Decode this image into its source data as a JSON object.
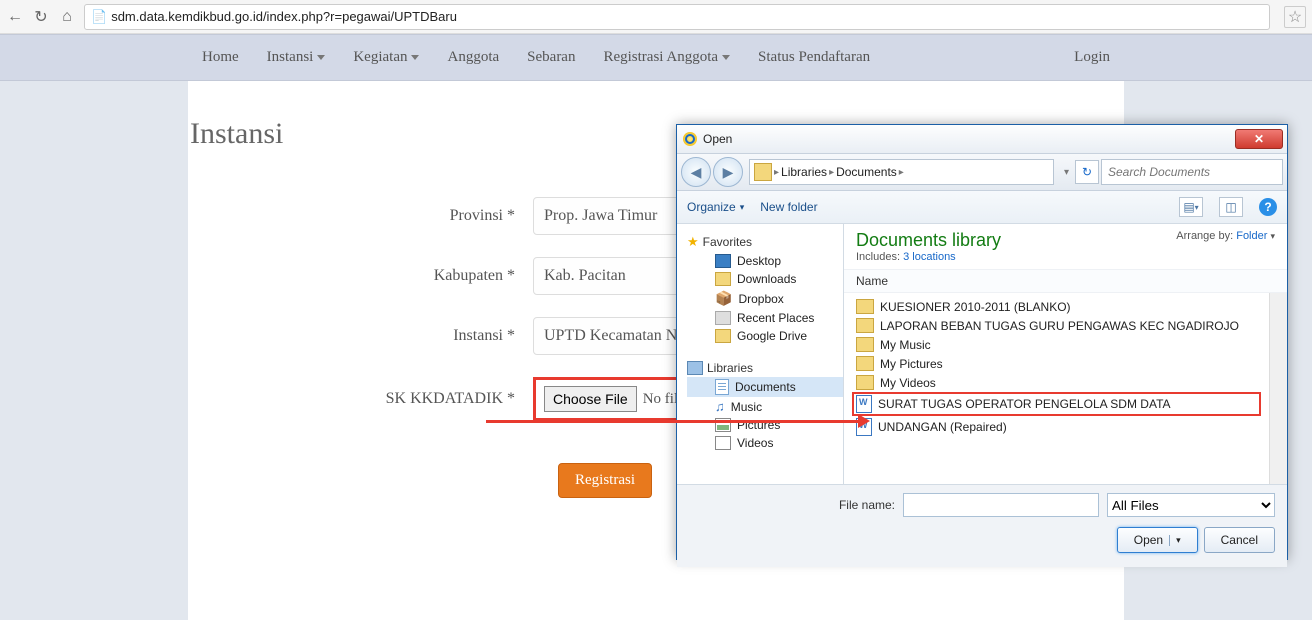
{
  "browser": {
    "url": "sdm.data.kemdikbud.go.id/index.php?r=pegawai/UPTDBaru"
  },
  "nav": {
    "items": [
      "Home",
      "Instansi",
      "Kegiatan",
      "Anggota",
      "Sebaran",
      "Registrasi Anggota",
      "Status Pendaftaran"
    ],
    "dropdown_flags": [
      false,
      true,
      true,
      false,
      false,
      true,
      false
    ],
    "login": "Login"
  },
  "page": {
    "title": "Instansi",
    "labels": {
      "provinsi": "Provinsi *",
      "kabupaten": "Kabupaten *",
      "instansi": "Instansi *",
      "sk": "SK KKDATADIK *"
    },
    "values": {
      "provinsi": "Prop. Jawa Timur",
      "kabupaten": "Kab. Pacitan",
      "instansi": "UPTD Kecamatan Ngadirojo"
    },
    "choose_file": "Choose File",
    "no_file": "No file chosen",
    "register": "Registrasi"
  },
  "dialog": {
    "title": "Open",
    "breadcrumb": [
      "Libraries",
      "Documents"
    ],
    "search_placeholder": "Search Documents",
    "organize": "Organize",
    "new_folder": "New folder",
    "lib_title": "Documents library",
    "includes_label": "Includes:",
    "includes_link": "3 locations",
    "arrange_label": "Arrange by:",
    "arrange_value": "Folder",
    "col_name": "Name",
    "tree": {
      "favorites": "Favorites",
      "fav_items": [
        "Desktop",
        "Downloads",
        "Dropbox",
        "Recent Places",
        "Google Drive"
      ],
      "libraries": "Libraries",
      "lib_items": [
        "Documents",
        "Music",
        "Pictures",
        "Videos"
      ]
    },
    "files": [
      {
        "type": "folder",
        "name": "KUESIONER 2010-2011 (BLANKO)"
      },
      {
        "type": "folder",
        "name": "LAPORAN BEBAN TUGAS GURU PENGAWAS KEC NGADIROJO"
      },
      {
        "type": "folder",
        "name": "My Music"
      },
      {
        "type": "folder",
        "name": "My Pictures"
      },
      {
        "type": "folder",
        "name": "My Videos"
      },
      {
        "type": "word",
        "name": "SURAT TUGAS OPERATOR PENGELOLA SDM DATA",
        "highlight": true
      },
      {
        "type": "word",
        "name": "UNDANGAN (Repaired)"
      }
    ],
    "file_name_label": "File name:",
    "filter": "All Files",
    "open": "Open",
    "cancel": "Cancel"
  }
}
